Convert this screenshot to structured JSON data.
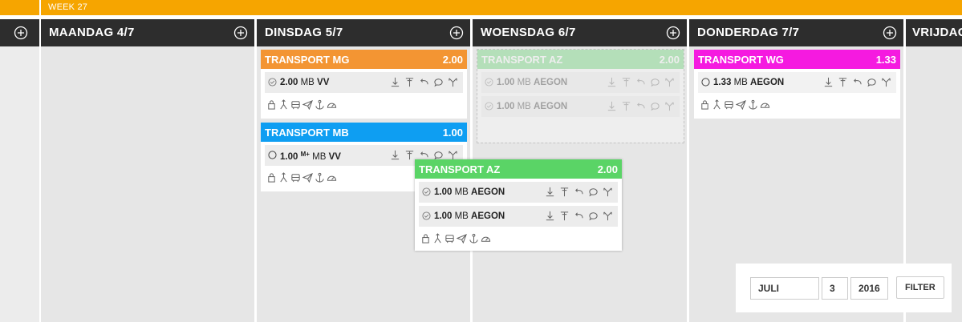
{
  "week": {
    "label": "WEEK 27"
  },
  "colors": {
    "orange": "#F39533",
    "blue": "#0E9EF2",
    "green": "#5AD466",
    "magenta": "#F51AE0",
    "header": "#2D2D2D",
    "weekbar": "#F6A500"
  },
  "days": [
    {
      "title": "MAANDAG 4/7"
    },
    {
      "title": "DINSDAG 5/7"
    },
    {
      "title": "WOENSDAG 6/7"
    },
    {
      "title": "DONDERDAG 7/7"
    },
    {
      "title": "VRIJDAG"
    }
  ],
  "cards": {
    "mg": {
      "name": "TRANSPORT MG",
      "qty": "2.00",
      "items": [
        {
          "amount": "2.00",
          "unit": "MB",
          "code": "VV"
        }
      ]
    },
    "mb": {
      "name": "TRANSPORT MB",
      "qty": "1.00",
      "items": [
        {
          "amount": "1.00",
          "sup": "M+",
          "unit": "MB",
          "code": "VV"
        }
      ]
    },
    "az_ghost": {
      "name": "TRANSPORT AZ",
      "qty": "2.00",
      "items": [
        {
          "amount": "1.00",
          "unit": "MB",
          "code": "AEGON"
        },
        {
          "amount": "1.00",
          "unit": "MB",
          "code": "AEGON"
        }
      ]
    },
    "az_drag": {
      "name": "TRANSPORT AZ",
      "qty": "2.00",
      "items": [
        {
          "amount": "1.00",
          "unit": "MB",
          "code": "AEGON"
        },
        {
          "amount": "1.00",
          "unit": "MB",
          "code": "AEGON"
        }
      ]
    },
    "wg": {
      "name": "TRANSPORT WG",
      "qty": "1.33",
      "items": [
        {
          "amount": "1.33",
          "unit": "MB",
          "code": "AEGON"
        }
      ]
    }
  },
  "filter": {
    "month": "JULI",
    "week": "3",
    "year": "2016",
    "button": "FILTER"
  }
}
